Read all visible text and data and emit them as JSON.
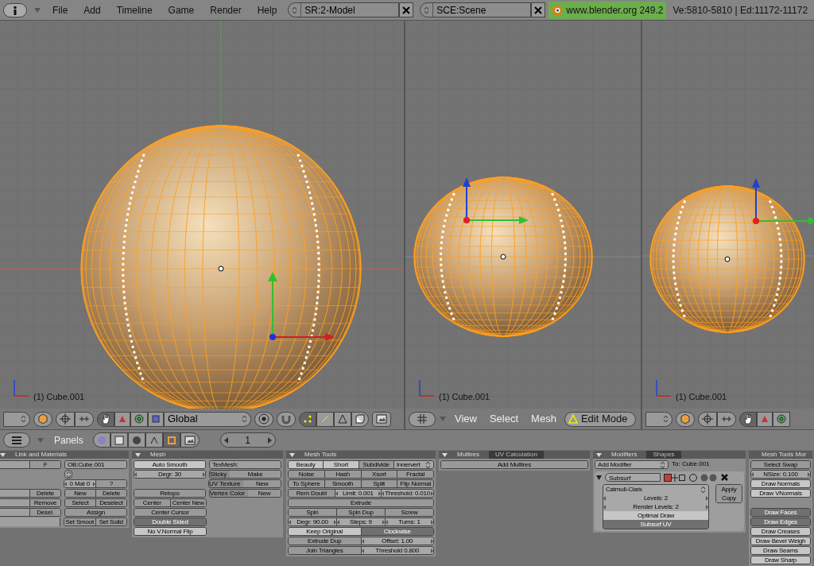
{
  "topbar": {
    "menus": [
      "File",
      "Add",
      "Timeline",
      "Game",
      "Render",
      "Help"
    ],
    "screen": "SR:2-Model",
    "scene": "SCE:Scene",
    "version": "www.blender.org 249.2",
    "stats": "Ve:5810-5810 | Ed:11172-11172"
  },
  "viewports": [
    {
      "kind": "tools",
      "label": "(1) Cube.001",
      "orientation": "Global"
    },
    {
      "kind": "menus",
      "label": "(1) Cube.001",
      "menus": [
        "View",
        "Select",
        "Mesh"
      ],
      "mode": "Edit Mode"
    },
    {
      "kind": "tools",
      "label": "(1) Cube.001"
    }
  ],
  "buttons_header": {
    "label": "Panels",
    "frame": "1"
  },
  "panels": [
    {
      "tabs": [
        {
          "label": "Link and Materials",
          "selected": true
        }
      ],
      "rows": [
        [
          [
            {
              "kind": "blank"
            },
            {
              "kind": "button",
              "label": "F"
            }
          ],
          [
            {
              "kind": "field",
              "label": "OB:Cube.001"
            }
          ]
        ],
        [
          [
            {
              "kind": "spacer"
            }
          ],
          [
            {
              "kind": "updown"
            }
          ]
        ],
        [
          [
            {
              "kind": "spacer"
            }
          ],
          [
            {
              "kind": "num",
              "label": "0 Mat 0"
            },
            {
              "kind": "button",
              "label": "?"
            }
          ]
        ],
        [
          [
            {
              "kind": "blank"
            },
            {
              "kind": "button",
              "label": "Delete"
            }
          ],
          [
            {
              "kind": "button",
              "label": "New"
            },
            {
              "kind": "button",
              "label": "Delete"
            }
          ]
        ],
        [
          [
            {
              "kind": "blank"
            },
            {
              "kind": "button",
              "label": "Remove"
            }
          ],
          [
            {
              "kind": "button",
              "label": "Select"
            },
            {
              "kind": "button",
              "label": "Deselect"
            }
          ]
        ],
        [
          [
            {
              "kind": "blank"
            },
            {
              "kind": "button",
              "label": "Desel."
            }
          ],
          [
            {
              "kind": "button",
              "label": "Assign"
            }
          ]
        ],
        [
          [
            {
              "kind": "blank"
            }
          ],
          [
            {
              "kind": "button",
              "label": "Set Smoot"
            },
            {
              "kind": "button",
              "label": "Set Solid"
            }
          ]
        ]
      ]
    },
    {
      "tabs": [
        {
          "label": "Mesh",
          "selected": true
        }
      ],
      "rows": [
        [
          [
            {
              "kind": "toggle",
              "label": "Auto Smooth",
              "on": false
            }
          ],
          [
            {
              "kind": "field",
              "label": "TexMesh:"
            }
          ]
        ],
        [
          [
            {
              "kind": "num",
              "label": "Degr: 30"
            }
          ],
          [
            {
              "kind": "label",
              "label": "Sticky"
            },
            {
              "kind": "button",
              "label": "Make"
            }
          ]
        ],
        [
          [
            {
              "kind": "spacer"
            }
          ],
          [
            {
              "kind": "label",
              "label": "UV Texture"
            },
            {
              "kind": "button",
              "label": "New"
            }
          ]
        ],
        [
          [
            {
              "kind": "button",
              "label": "Retopo"
            }
          ],
          [
            {
              "kind": "label",
              "label": "Vertex Color"
            },
            {
              "kind": "button",
              "label": "New"
            }
          ]
        ],
        [
          [
            {
              "kind": "button",
              "label": "Center"
            },
            {
              "kind": "button",
              "label": "Center New"
            }
          ],
          [
            {
              "kind": "spacer"
            }
          ]
        ],
        [
          [
            {
              "kind": "button",
              "label": "Center Cursor"
            }
          ],
          [
            {
              "kind": "spacer"
            }
          ]
        ],
        [
          [
            {
              "kind": "toggle",
              "label": "Double Sided",
              "on": true
            }
          ],
          [
            {
              "kind": "spacer"
            }
          ]
        ],
        [
          [
            {
              "kind": "toggle",
              "label": "No V.Normal Flip",
              "on": false
            }
          ],
          [
            {
              "kind": "spacer"
            }
          ]
        ]
      ]
    },
    {
      "tabs": [
        {
          "label": "Mesh Tools",
          "selected": true
        }
      ],
      "rows": [
        [
          [
            {
              "kind": "toggle",
              "label": "Beauty",
              "on": false
            },
            {
              "kind": "toggle",
              "label": "Short",
              "on": false
            },
            {
              "kind": "button",
              "label": "Subdivide"
            },
            {
              "kind": "menu",
              "label": "Innervert"
            }
          ]
        ],
        [
          [
            {
              "kind": "button",
              "label": "Noise"
            },
            {
              "kind": "button",
              "label": "Hash"
            },
            {
              "kind": "button",
              "label": "Xsort"
            },
            {
              "kind": "button",
              "label": "Fractal"
            }
          ]
        ],
        [
          [
            {
              "kind": "button",
              "label": "To Sphere"
            },
            {
              "kind": "button",
              "label": "Smooth"
            },
            {
              "kind": "button",
              "label": "Split"
            },
            {
              "kind": "button",
              "label": "Flip Normal"
            }
          ]
        ],
        [
          [
            {
              "kind": "button",
              "label": "Rem Doubl"
            },
            {
              "kind": "num",
              "label": "Limit: 0.001"
            },
            {
              "kind": "num",
              "label": "Threshold: 0.010"
            }
          ]
        ],
        [
          [
            {
              "kind": "button",
              "label": "Extrude"
            }
          ]
        ],
        [
          [
            {
              "kind": "button",
              "label": "Spin"
            },
            {
              "kind": "button",
              "label": "Spin Dup"
            },
            {
              "kind": "button",
              "label": "Screw"
            }
          ]
        ],
        [
          [
            {
              "kind": "num",
              "label": "Degr: 90.00"
            },
            {
              "kind": "num",
              "label": "Steps: 9"
            },
            {
              "kind": "num",
              "label": "Turns: 1"
            }
          ]
        ],
        [
          [
            {
              "kind": "toggle",
              "label": "Keep Original",
              "on": false
            },
            {
              "kind": "toggle",
              "label": "Clockwise",
              "on": true
            }
          ]
        ],
        [
          [
            {
              "kind": "button",
              "label": "Extrude Dup"
            },
            {
              "kind": "num",
              "label": "Offset: 1.00"
            }
          ]
        ],
        [
          [
            {
              "kind": "button",
              "label": "Join Triangles"
            },
            {
              "kind": "num",
              "label": "Threshold 0.800"
            }
          ]
        ]
      ]
    },
    {
      "tabs": [
        {
          "label": "Multires",
          "selected": true
        },
        {
          "label": "UV Calculation",
          "selected": false
        }
      ],
      "rows": [
        [
          [
            {
              "kind": "button",
              "label": "Add Multires"
            }
          ]
        ]
      ]
    },
    {
      "tabs": [
        {
          "label": "Modifiers",
          "selected": true
        },
        {
          "label": "Shapes",
          "selected": false
        }
      ],
      "rows": [
        [
          [
            {
              "kind": "menu",
              "label": "Add Modifier"
            }
          ],
          [
            {
              "kind": "label",
              "label": "To: Cube.001"
            }
          ]
        ]
      ],
      "modifier": {
        "name": "Subsurf",
        "type": "Catmull-Clark",
        "levels": "Levels: 2",
        "render_levels": "Render Levels: 2",
        "options": [
          {
            "label": "Optimal Draw",
            "on": false
          },
          {
            "label": "Subsurf UV",
            "on": true
          }
        ],
        "actions": [
          "Apply",
          "Copy"
        ]
      }
    },
    {
      "tabs": [
        {
          "label": "Mesh Tools Mor",
          "selected": true
        }
      ],
      "rows": [
        [
          [
            {
              "kind": "button",
              "label": "Select Swap"
            }
          ]
        ],
        [
          [
            {
              "kind": "num",
              "label": "NSize: 0.100"
            }
          ]
        ],
        [
          [
            {
              "kind": "toggle",
              "label": "Draw Normals",
              "on": false
            }
          ]
        ],
        [
          [
            {
              "kind": "toggle",
              "label": "Draw VNormals",
              "on": false
            }
          ]
        ],
        [
          [
            {
              "kind": "spacer"
            }
          ]
        ],
        [
          [
            {
              "kind": "toggle",
              "label": "Draw Faces",
              "on": true
            }
          ]
        ],
        [
          [
            {
              "kind": "toggle",
              "label": "Draw Edges",
              "on": true
            }
          ]
        ],
        [
          [
            {
              "kind": "toggle",
              "label": "Draw Creases",
              "on": false
            }
          ]
        ],
        [
          [
            {
              "kind": "toggle",
              "label": "Draw Bevel Weigh",
              "on": false
            }
          ]
        ],
        [
          [
            {
              "kind": "toggle",
              "label": "Draw Seams",
              "on": false
            }
          ]
        ],
        [
          [
            {
              "kind": "toggle",
              "label": "Draw Sharp",
              "on": false
            }
          ]
        ]
      ]
    }
  ]
}
